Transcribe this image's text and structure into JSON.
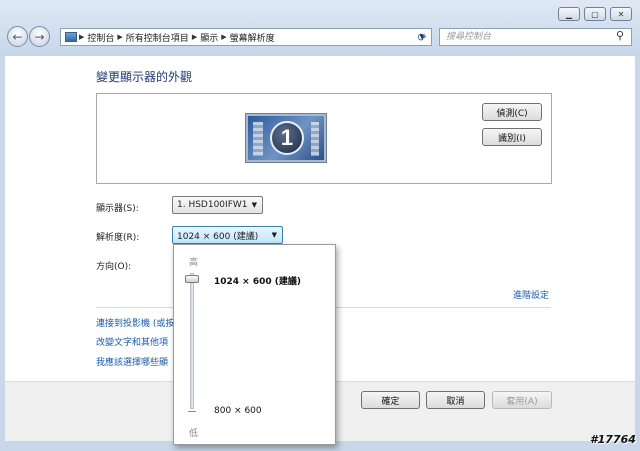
{
  "window": {
    "caption_buttons": [
      "minimize-icon",
      "maximize-icon",
      "close-icon"
    ]
  },
  "address_bar": {
    "crumbs": [
      "控制台",
      "所有控制台項目",
      "顯示",
      "螢幕解析度"
    ],
    "search_placeholder": "搜尋控制台",
    "refresh_icon": "refresh-icon",
    "search_icon": "search-icon"
  },
  "page": {
    "title": "變更顯示器的外觀",
    "detect_button": "偵測(C)",
    "identify_button": "識別(I)",
    "monitor_number": "1",
    "display_label": "顯示器(S):",
    "display_value": "1. HSD100IFW1",
    "resolution_label": "解析度(R):",
    "resolution_value": "1024 × 600 (建議)",
    "orientation_label": "方向(O):",
    "advanced_link": "進階設定",
    "links": [
      "連接到投影機 (或按",
      "改變文字和其他項",
      "我應該選擇哪些顯"
    ]
  },
  "resolution_popup": {
    "high_label": "高",
    "low_label": "低",
    "top_option": "1024 × 600 (建議)",
    "bottom_option": "800 × 600",
    "selected_option": "1024 × 600 (建議)"
  },
  "footer": {
    "ok_button": "確定",
    "cancel_button": "取消",
    "apply_button": "套用(A)"
  },
  "watermark": "#17764"
}
